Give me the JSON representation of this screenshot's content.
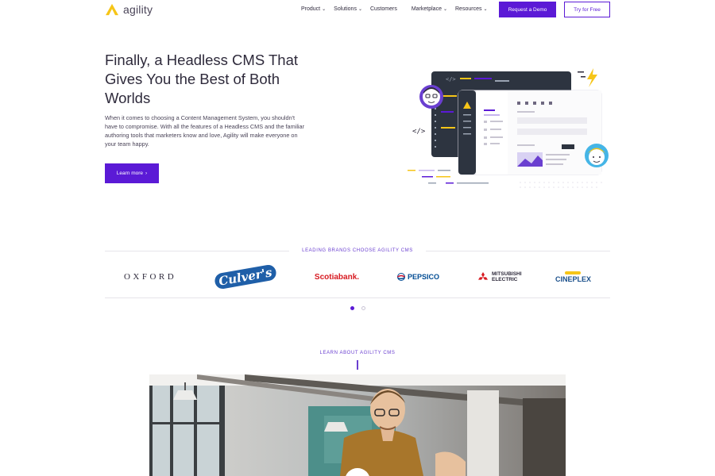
{
  "header": {
    "logo_text": "agility",
    "nav": [
      {
        "label": "Product",
        "caret": true
      },
      {
        "label": "Solutions",
        "caret": true
      },
      {
        "label": "Customers",
        "caret": false
      },
      {
        "label": "Marketplace",
        "caret": true
      },
      {
        "label": "Resources",
        "caret": true
      }
    ],
    "demo_label": "Request a Demo",
    "try_label": "Try for Free"
  },
  "hero": {
    "title": "Finally, a Headless CMS That Gives You the Best of Both Worlds",
    "body": "When it comes to choosing a Content Management System, you shouldn't have to compromise. With all the features of a Headless CMS and the familiar authoring tools that marketers know and love, Agility will make everyone on your team happy.",
    "cta_label": "Learn more",
    "code_tag": "</>"
  },
  "brands": {
    "heading": "LEADING BRANDS CHOOSE AGILITY CMS",
    "logos": [
      {
        "name": "oxford-logo",
        "text": "OXFORD"
      },
      {
        "name": "culvers-logo",
        "text": "Culver's"
      },
      {
        "name": "scotiabank-logo",
        "text": "Scotiabank."
      },
      {
        "name": "pepsico-logo",
        "text": "PEPSICO"
      },
      {
        "name": "mitsubishi-electric-logo",
        "text": "MITSUBISHI ELECTRIC"
      },
      {
        "name": "cineplex-logo",
        "text": "CINEPLEX"
      }
    ],
    "carousel_pages": 2,
    "carousel_active": 1
  },
  "learn": {
    "heading": "LEARN ABOUT AGILITY CMS"
  },
  "colors": {
    "brand_purple": "#5b1ad6",
    "logo_yellow": "#f6c518",
    "text_dark": "#2e2a3b"
  }
}
